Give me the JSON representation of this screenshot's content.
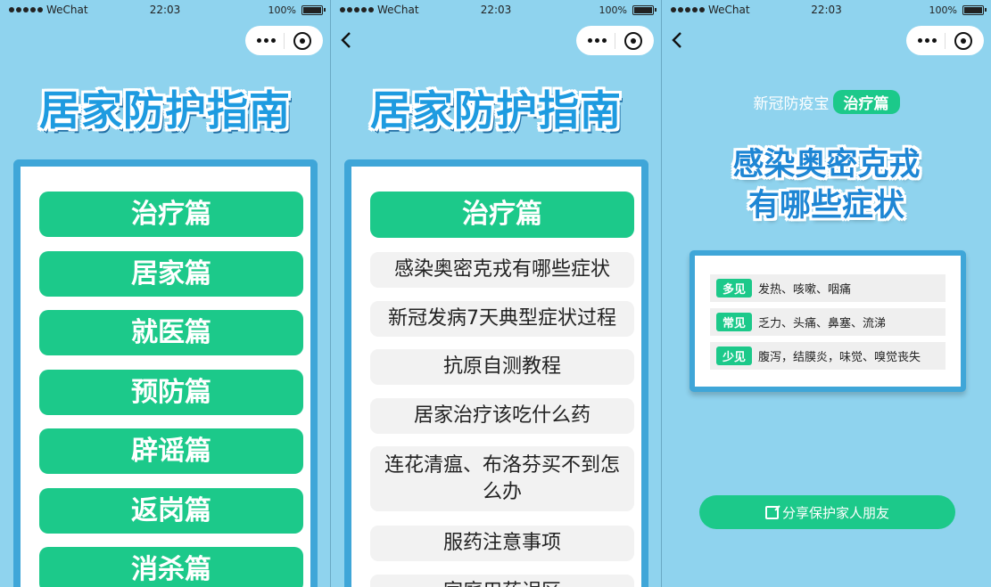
{
  "status": {
    "carrier": "WeChat",
    "time": "22:03",
    "battery": "100%"
  },
  "panel1": {
    "logo": "居家防护指南",
    "menu": [
      "治疗篇",
      "居家篇",
      "就医篇",
      "预防篇",
      "辟谣篇",
      "返岗篇",
      "消杀篇"
    ]
  },
  "panel2": {
    "logo": "居家防护指南",
    "header_button": "治疗篇",
    "topics": [
      "感染奥密克戎有哪些症状",
      "新冠发病7天典型症状过程",
      "抗原自测教程",
      "居家治疗该吃什么药",
      "连花清瘟、布洛芬买不到怎么办",
      "服药注意事项",
      "家庭用药误区"
    ]
  },
  "panel3": {
    "brand": "新冠防疫宝",
    "tag": "治疗篇",
    "title_line1": "感染奥密克戎",
    "title_line2": "有哪些症状",
    "symptoms": [
      {
        "label": "多见",
        "text": "发热、咳嗽、咽痛"
      },
      {
        "label": "常见",
        "text": "乏力、头痛、鼻塞、流涕"
      },
      {
        "label": "少见",
        "text": "腹泻，结膜炎，味觉、嗅觉丧失"
      }
    ],
    "share_label": "分享保护家人朋友"
  },
  "colors": {
    "bg": "#8fd3ee",
    "accent_green": "#1cc98a",
    "card_border": "#3fa6d8",
    "logo_blue": "#1e9be0"
  }
}
